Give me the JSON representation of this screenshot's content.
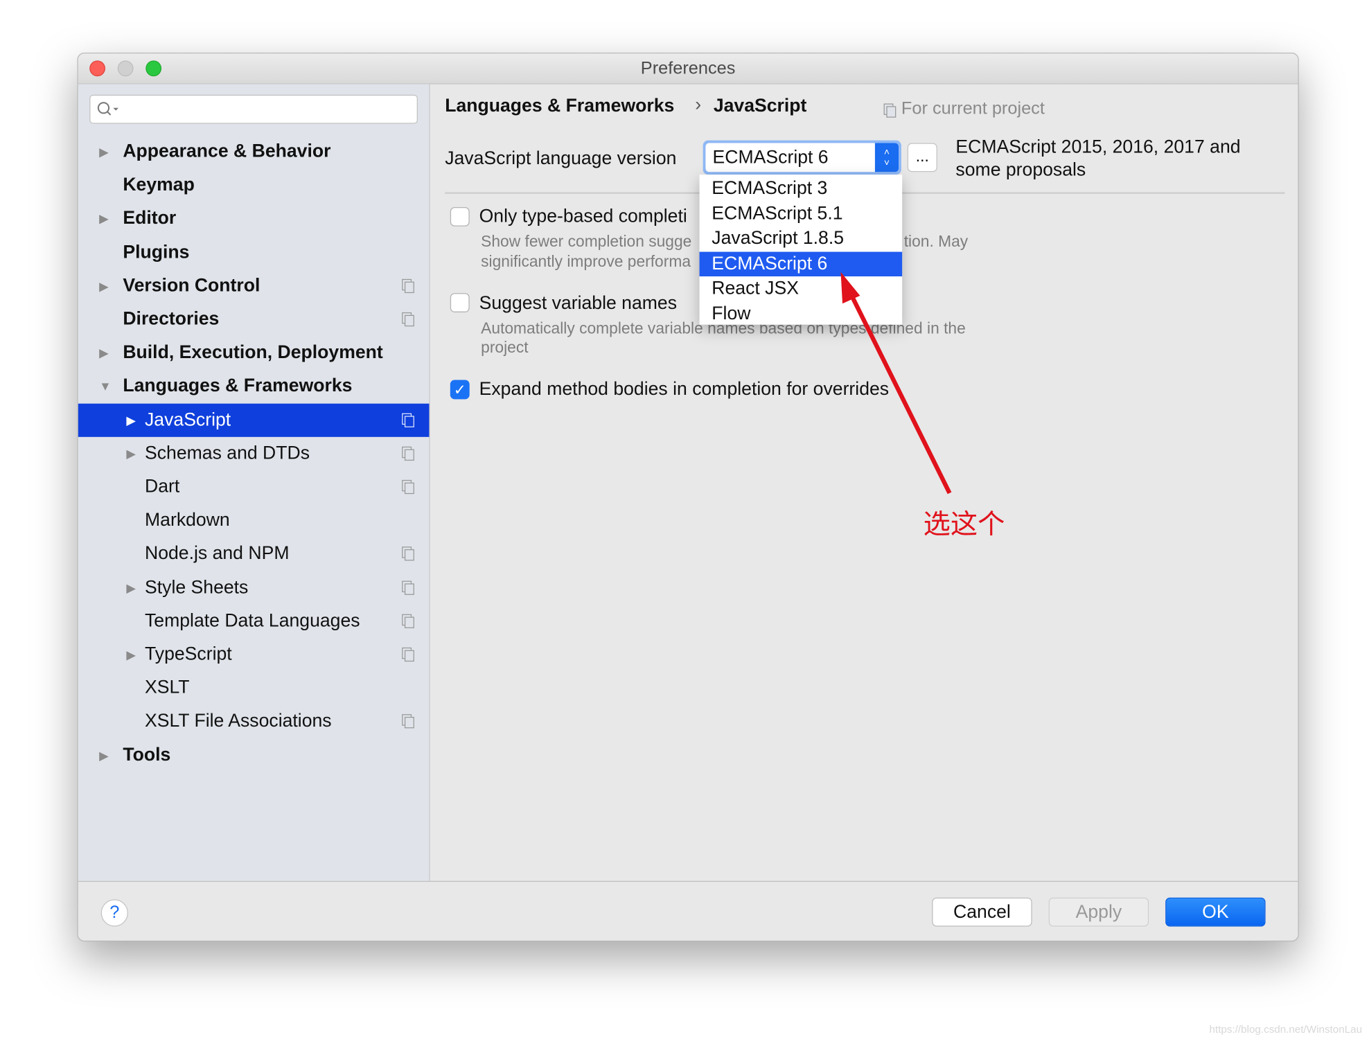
{
  "window": {
    "title": "Preferences"
  },
  "sidebar": {
    "search": {
      "value": "",
      "placeholder": ""
    },
    "items": [
      {
        "label": "Appearance & Behavior",
        "level": 0,
        "expandable": true,
        "bold": true,
        "project": false
      },
      {
        "label": "Keymap",
        "level": 0,
        "expandable": false,
        "bold": true,
        "project": false
      },
      {
        "label": "Editor",
        "level": 0,
        "expandable": true,
        "bold": true,
        "project": false
      },
      {
        "label": "Plugins",
        "level": 0,
        "expandable": false,
        "bold": true,
        "project": false
      },
      {
        "label": "Version Control",
        "level": 0,
        "expandable": true,
        "bold": true,
        "project": true
      },
      {
        "label": "Directories",
        "level": 0,
        "expandable": false,
        "bold": true,
        "project": true
      },
      {
        "label": "Build, Execution, Deployment",
        "level": 0,
        "expandable": true,
        "bold": true,
        "project": false
      },
      {
        "label": "Languages & Frameworks",
        "level": 0,
        "expandable": true,
        "expanded": true,
        "bold": true,
        "project": false
      },
      {
        "label": "JavaScript",
        "level": 1,
        "expandable": true,
        "bold": false,
        "project": true,
        "selected": true
      },
      {
        "label": "Schemas and DTDs",
        "level": 1,
        "expandable": true,
        "bold": false,
        "project": true
      },
      {
        "label": "Dart",
        "level": 1,
        "expandable": false,
        "bold": false,
        "project": true
      },
      {
        "label": "Markdown",
        "level": 1,
        "expandable": false,
        "bold": false,
        "project": false
      },
      {
        "label": "Node.js and NPM",
        "level": 1,
        "expandable": false,
        "bold": false,
        "project": true
      },
      {
        "label": "Style Sheets",
        "level": 1,
        "expandable": true,
        "bold": false,
        "project": true
      },
      {
        "label": "Template Data Languages",
        "level": 1,
        "expandable": false,
        "bold": false,
        "project": true
      },
      {
        "label": "TypeScript",
        "level": 1,
        "expandable": true,
        "bold": false,
        "project": true
      },
      {
        "label": "XSLT",
        "level": 1,
        "expandable": false,
        "bold": false,
        "project": false
      },
      {
        "label": "XSLT File Associations",
        "level": 1,
        "expandable": false,
        "bold": false,
        "project": true
      },
      {
        "label": "Tools",
        "level": 0,
        "expandable": true,
        "bold": true,
        "project": false
      }
    ]
  },
  "main": {
    "breadcrumb": [
      "Languages & Frameworks",
      "JavaScript"
    ],
    "breadcrumb_separator": "›",
    "scope": "For current project",
    "version_label": "JavaScript language version",
    "version_value": "ECMAScript 6",
    "more_button": "...",
    "version_description_1": "ECMAScript 2015, 2016, 2017 and",
    "version_description_2": "some proposals",
    "dropdown_options": [
      "ECMAScript 3",
      "ECMAScript 5.1",
      "JavaScript 1.8.5",
      "ECMAScript 6",
      "React JSX",
      "Flow"
    ],
    "dropdown_selected": "ECMAScript 6",
    "options": [
      {
        "label": "Only type-based completi",
        "checked": false,
        "desc1": "Show fewer completion sugge",
        "desc1b": "tion. May",
        "desc2": "significantly improve performa"
      },
      {
        "label": "Suggest variable names",
        "checked": false,
        "desc1": "Automatically complete variable names based on types defined in the",
        "desc2": "project"
      },
      {
        "label": "Expand method bodies in completion for overrides",
        "checked": true
      }
    ]
  },
  "annotation": {
    "text": "选这个",
    "color": "#e0121b"
  },
  "footer": {
    "help": "?",
    "cancel": "Cancel",
    "apply": "Apply",
    "ok": "OK"
  },
  "colors": {
    "accent": "#1a73f5",
    "selection": "#0f3fdc"
  },
  "watermark": "https://blog.csdn.net/WinstonLau"
}
